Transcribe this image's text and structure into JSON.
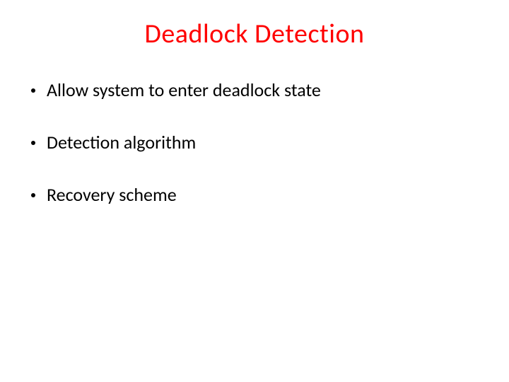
{
  "title": "Deadlock Detection",
  "bullets": {
    "0": "Allow system to enter deadlock state",
    "1": "Detection algorithm",
    "2": "Recovery scheme"
  }
}
